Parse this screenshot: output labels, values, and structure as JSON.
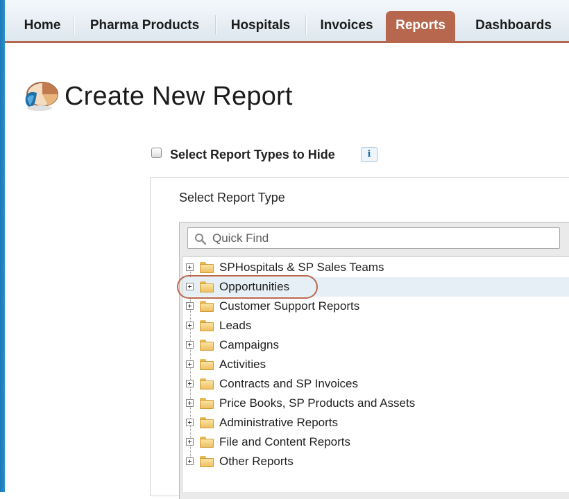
{
  "nav": {
    "tabs": [
      {
        "label": "Home"
      },
      {
        "label": "Pharma Products"
      },
      {
        "label": "Hospitals"
      },
      {
        "label": "Invoices"
      },
      {
        "label": "Reports",
        "active": true
      },
      {
        "label": "Dashboards"
      }
    ]
  },
  "page": {
    "title": "Create New Report",
    "title_icon": "reports-pie-icon"
  },
  "options": {
    "hide_types_label": "Select Report Types to Hide",
    "hide_types_checked": false,
    "info_icon_glyph": "i"
  },
  "report_type": {
    "heading": "Select Report Type",
    "search": {
      "placeholder": "Quick Find",
      "value": ""
    },
    "folders": [
      {
        "label": "SPHospitals & SP Sales Teams"
      },
      {
        "label": "Opportunities",
        "selected": true
      },
      {
        "label": "Customer Support Reports"
      },
      {
        "label": "Leads"
      },
      {
        "label": "Campaigns"
      },
      {
        "label": "Activities"
      },
      {
        "label": "Contracts and SP Invoices"
      },
      {
        "label": "Price Books, SP Products and Assets"
      },
      {
        "label": "Administrative Reports"
      },
      {
        "label": "File and Content Reports"
      },
      {
        "label": "Other Reports"
      }
    ]
  },
  "colors": {
    "accent": "#b7674e",
    "left_strip": "#1a78b5",
    "selected_row": "#e6eff5"
  }
}
